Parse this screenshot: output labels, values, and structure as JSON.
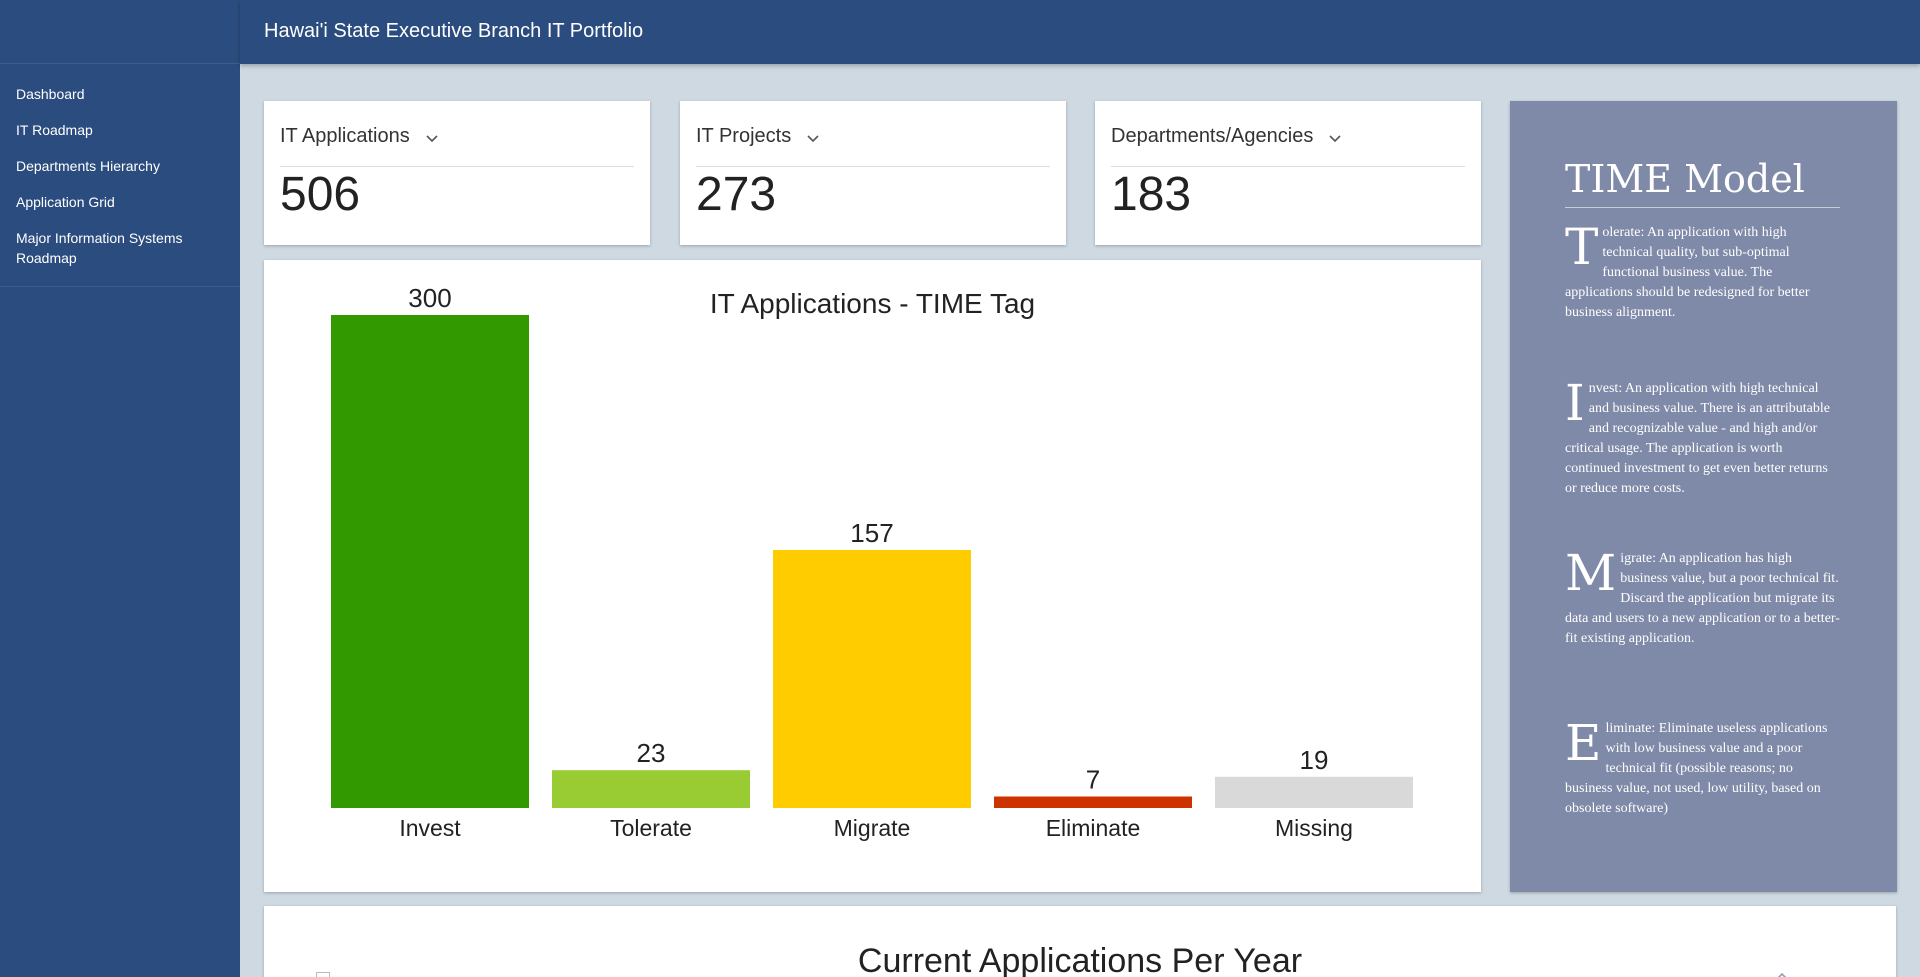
{
  "app": {
    "title": "Hawai'i State Executive Branch IT Portfolio"
  },
  "sidebar": {
    "items": [
      {
        "label": "Dashboard"
      },
      {
        "label": "IT Roadmap"
      },
      {
        "label": "Departments Hierarchy"
      },
      {
        "label": "Application Grid"
      },
      {
        "label": "Major Information Systems Roadmap"
      }
    ]
  },
  "stats": [
    {
      "label": "IT Applications",
      "value": "506"
    },
    {
      "label": "IT Projects",
      "value": "273"
    },
    {
      "label": "Departments/Agencies",
      "value": "183"
    }
  ],
  "chart_data": {
    "type": "bar",
    "title": "IT Applications - TIME Tag",
    "categories": [
      "Invest",
      "Tolerate",
      "Migrate",
      "Eliminate",
      "Missing"
    ],
    "values": [
      300,
      23,
      157,
      7,
      19
    ],
    "colors": [
      "#339900",
      "#99cc33",
      "#ffcc00",
      "#cc3300",
      "#d9d9d9"
    ],
    "xlabel": "",
    "ylabel": "",
    "ylim": [
      0,
      300
    ],
    "grid": false,
    "legend": "none"
  },
  "time_model": {
    "title": "TIME Model",
    "items": [
      {
        "letter": "T",
        "text": "olerate: An application with high technical quality, but sub-optimal functional business value. The applications should be redesigned for better business alignment."
      },
      {
        "letter": "I",
        "text": "nvest: An application with high technical and business value. There is an attributable and recognizable value - and high and/or critical usage. The application is worth continued investment to get even better returns or reduce more costs."
      },
      {
        "letter": "M",
        "text": "igrate: An application has high business value, but a poor technical fit. Discard the application but migrate its data and users to a new application or to a better-fit existing application."
      },
      {
        "letter": "E",
        "text": "liminate: Eliminate useless applications with low business value and a poor technical fit (possible reasons; no business value, not used, low utility, based on obsolete software)"
      }
    ]
  },
  "bottom_panel": {
    "title": "Current Applications Per Year"
  }
}
